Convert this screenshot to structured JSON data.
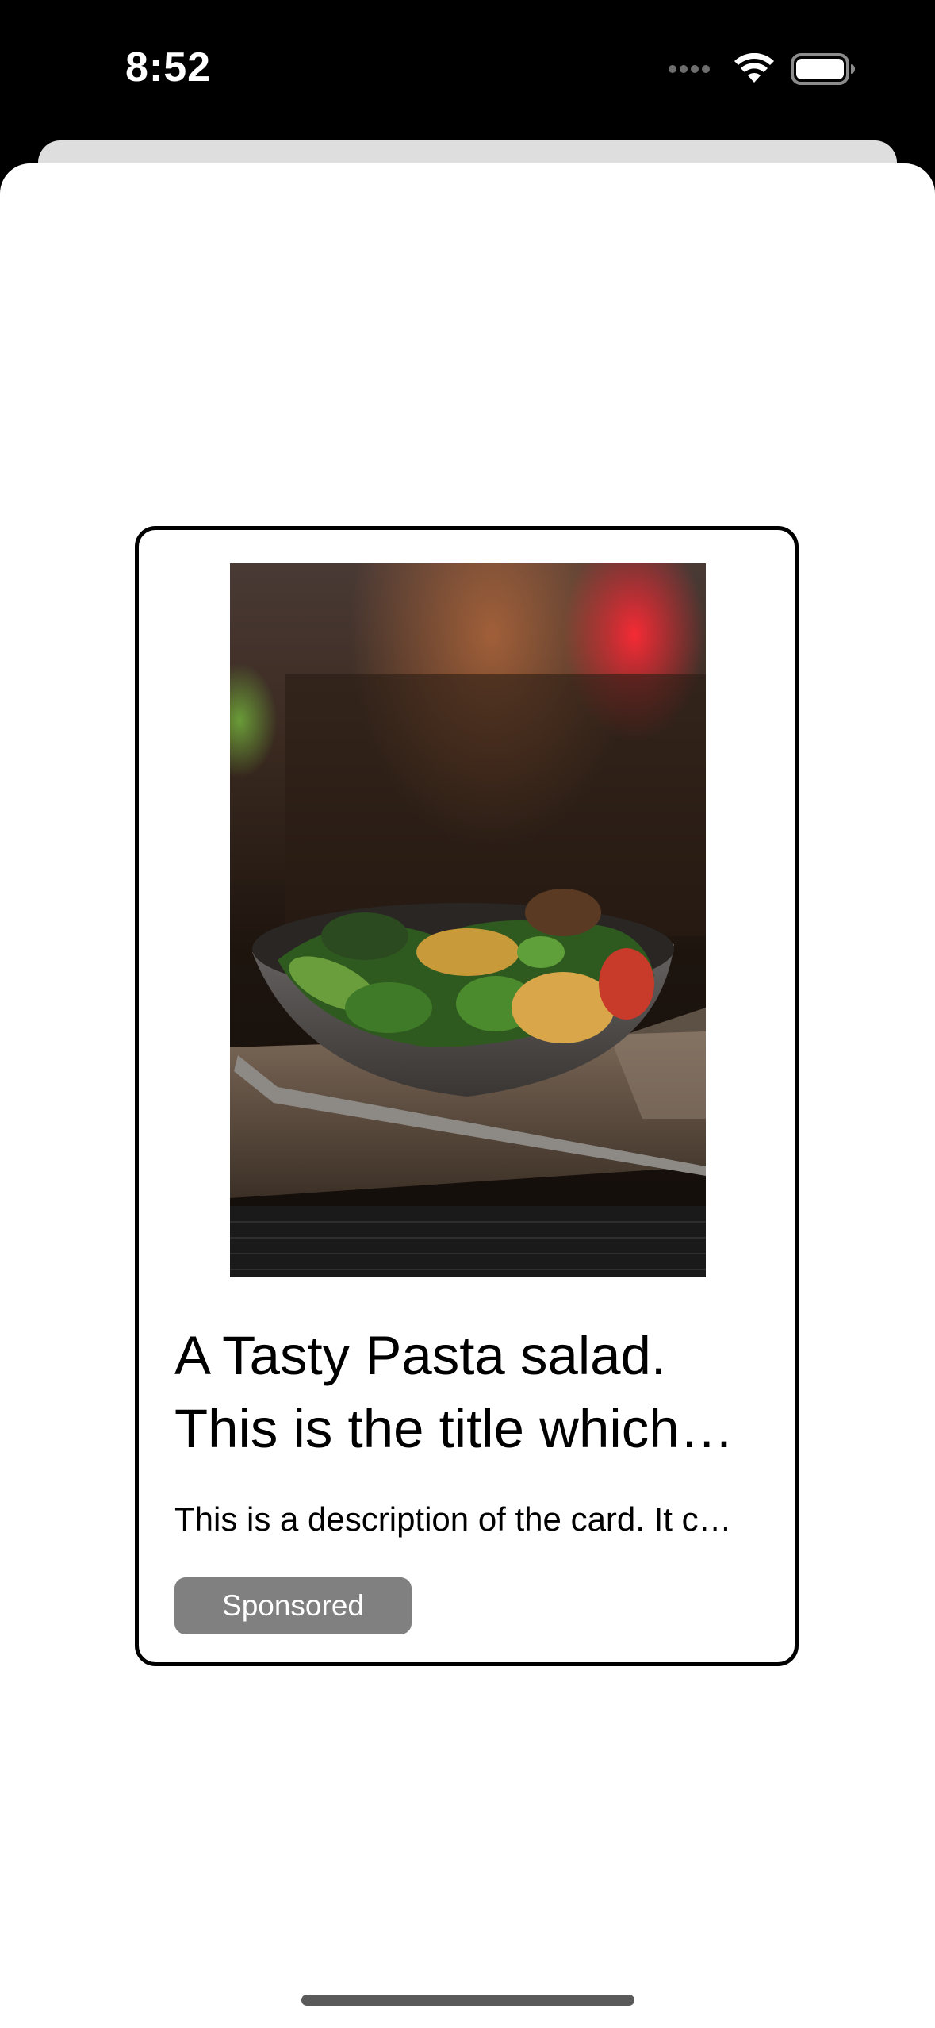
{
  "status_bar": {
    "time": "8:52",
    "icons": [
      "cellular-signal-icon",
      "wifi-icon",
      "battery-icon"
    ]
  },
  "card": {
    "image": "pasta-salad-photo",
    "title": "A Tasty Pasta salad. This is the title which…",
    "description": "This is a description of the card. It c…",
    "badge": "Sponsored"
  },
  "colors": {
    "background": "#000000",
    "sheet": "#ffffff",
    "sheet_behind": "#dedede",
    "card_border": "#000000",
    "badge_background": "#808080",
    "badge_text": "#ffffff"
  }
}
